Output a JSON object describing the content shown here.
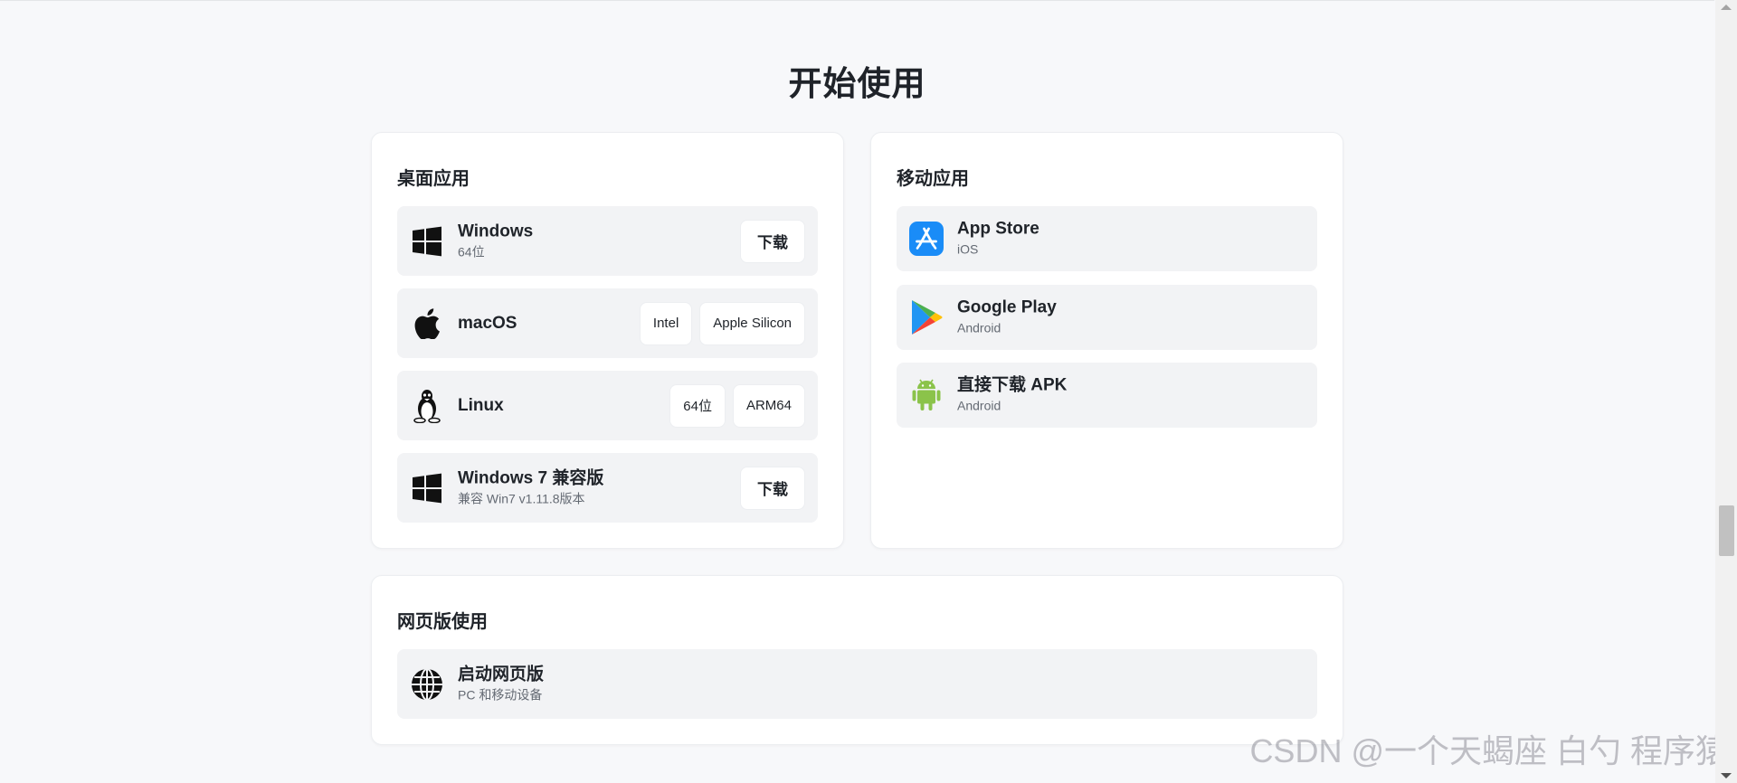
{
  "page": {
    "title": "开始使用"
  },
  "desktop": {
    "title": "桌面应用",
    "items": [
      {
        "icon": "windows-icon",
        "name": "Windows",
        "sub": "64位",
        "buttons": [
          "下载"
        ]
      },
      {
        "icon": "apple-icon",
        "name": "macOS",
        "sub": "",
        "buttons": [
          "Intel",
          "Apple Silicon"
        ]
      },
      {
        "icon": "linux-icon",
        "name": "Linux",
        "sub": "",
        "buttons": [
          "64位",
          "ARM64"
        ]
      },
      {
        "icon": "windows-icon",
        "name": "Windows 7 兼容版",
        "sub": "兼容 Win7 v1.11.8版本",
        "buttons": [
          "下载"
        ]
      }
    ]
  },
  "mobile": {
    "title": "移动应用",
    "items": [
      {
        "icon": "app-store-icon",
        "name": "App Store",
        "sub": "iOS"
      },
      {
        "icon": "google-play-icon",
        "name": "Google Play",
        "sub": "Android"
      },
      {
        "icon": "android-icon",
        "name": "直接下载 APK",
        "sub": "Android"
      }
    ]
  },
  "web": {
    "title": "网页版使用",
    "items": [
      {
        "icon": "globe-icon",
        "name": "启动网页版",
        "sub": "PC 和移动设备"
      }
    ]
  },
  "watermark": "CSDN @一个天蝎座 白勺 程序猿",
  "colors": {
    "background": "#f7f8fa",
    "card": "#ffffff",
    "item": "#f2f3f5",
    "text": "#1f2329",
    "subtext": "#646a73",
    "app_store_blue": "#1a8cf7",
    "android_green": "#8bc34a"
  }
}
